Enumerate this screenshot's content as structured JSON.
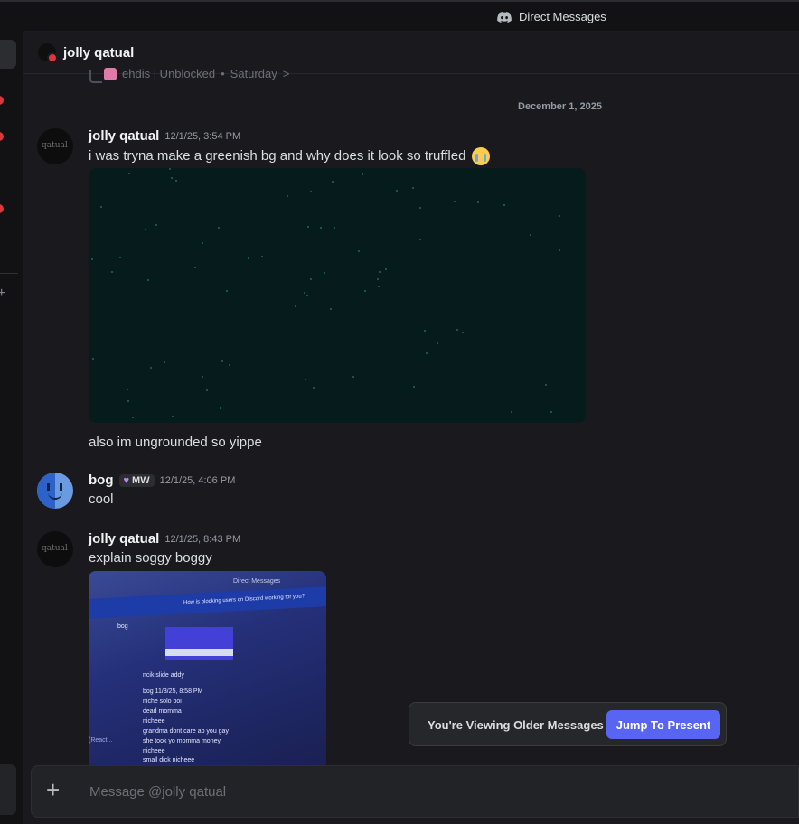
{
  "titlebar": {
    "title": "Direct Messages",
    "icon": "discord-icon"
  },
  "header": {
    "name": "jolly qatual",
    "status": "dnd"
  },
  "reply_preview": {
    "text": "ehdis | Unblocked",
    "time": "Saturday",
    "chevron": ">"
  },
  "date_divider": "December 1, 2025",
  "messages": [
    {
      "author": "jolly qatual",
      "timestamp": "12/1/25, 3:54 PM",
      "text": "i was tryna make a greenish bg and why does it look so truffled",
      "emoji": "loudly-crying-face",
      "attachment": "image-starfield",
      "followup": "also im ungrounded so yippe",
      "avatar_text": "qatual"
    },
    {
      "author": "bog",
      "tag": "MW",
      "timestamp": "12/1/25, 4:06 PM",
      "text": "cool"
    },
    {
      "author": "jolly qatual",
      "timestamp": "12/1/25, 8:43 PM",
      "text": "explain soggy boggy",
      "attachment": "image-screenshot-photo",
      "avatar_text": "qatual"
    }
  ],
  "photo": {
    "bar_title": "Direct Messages",
    "banner": "How is blocking users on Discord working for you?",
    "user": "bog",
    "line1": "ncik slide addy",
    "user2": "bog 11/3/25, 8:58 PM",
    "lines": [
      "niche solo boi",
      "dead momma",
      "nicheee",
      "grandma dont care ab you gay",
      "she took yo momma money",
      "nicheee",
      "small dick nicheee"
    ],
    "react": "(React..."
  },
  "overlay": {
    "label": "You're Viewing Older Messages",
    "button": "Jump To Present"
  },
  "composer": {
    "placeholder": "Message @jolly qatual",
    "add_icon": "+"
  },
  "colors": {
    "accent": "#5865f2",
    "dnd": "#da373c",
    "background": "#1a1a1e"
  }
}
